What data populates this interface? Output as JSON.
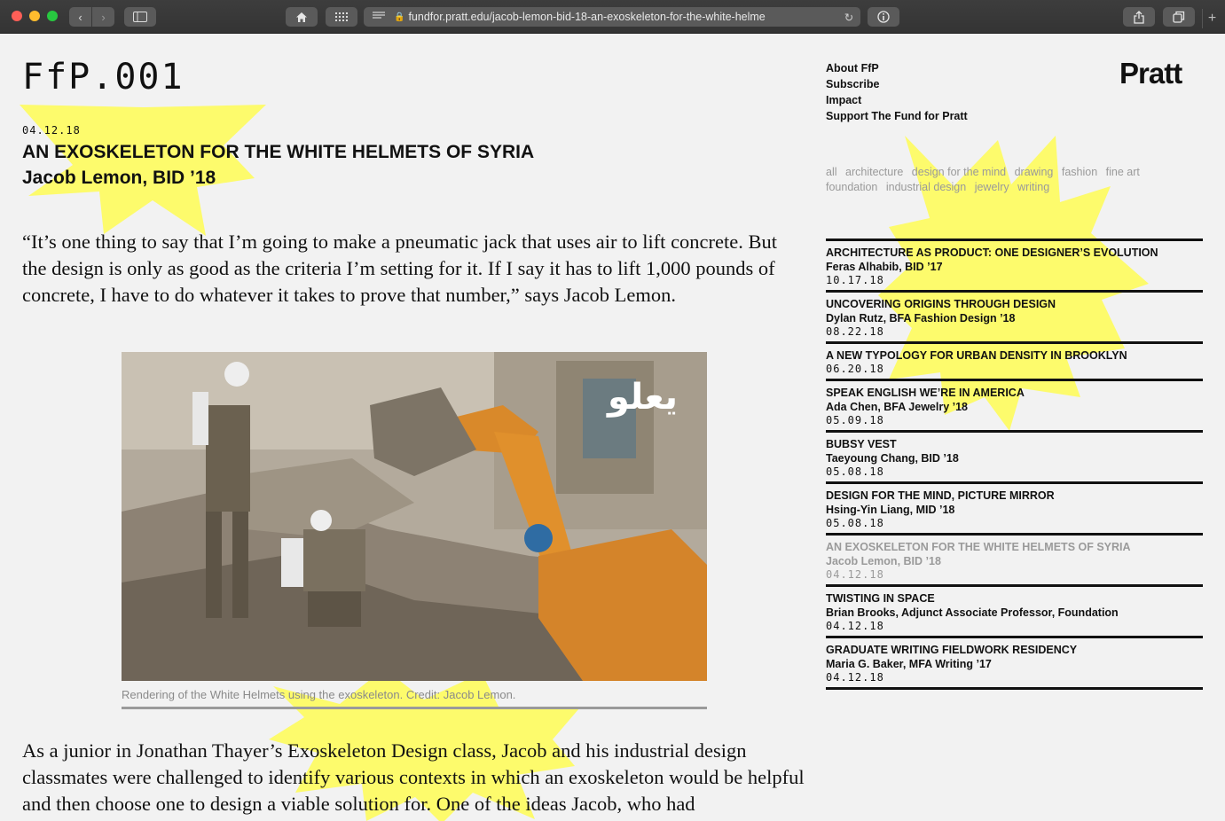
{
  "browser": {
    "url": "fundfor.pratt.edu/jacob-lemon-bid-18-an-exoskeleton-for-the-white-helme",
    "nav_back": "‹",
    "nav_forward": "›",
    "new_tab": "+"
  },
  "site": {
    "logo": "FfP.001",
    "brand": "Pratt",
    "menu": [
      "About FfP",
      "Subscribe",
      "Impact",
      "Support The Fund for Pratt"
    ],
    "filters": [
      "all",
      "architecture",
      "design for the mind",
      "drawing",
      "fashion",
      "fine art",
      "foundation",
      "industrial design",
      "jewelry",
      "writing"
    ]
  },
  "article": {
    "date": "04.12.18",
    "title": "AN EXOSKELETON FOR THE WHITE HELMETS OF SYRIA",
    "author": "Jacob Lemon, BID ’18",
    "paragraph1": "“It’s one thing to say that I’m going to make a pneumatic jack that uses air to lift concrete. But the design is only as good as the criteria I’m setting for it. If I say it has to lift 1,000 pounds of concrete, I have to do whatever it takes to prove that number,” says Jacob Lemon.",
    "image_overlay_text": "يعلو",
    "caption": "Rendering of the White Helmets using the exoskeleton. Credit: Jacob Lemon.",
    "paragraph2": "As a junior in Jonathan Thayer’s Exoskeleton Design class, Jacob and his industrial design classmates were challenged to identify various contexts in which an exoskeleton would be helpful and then choose one to design a viable solution for. One of the ideas Jacob, who had"
  },
  "posts": [
    {
      "title": "ARCHITECTURE AS PRODUCT: ONE DESIGNER’S EVOLUTION",
      "author": "Feras Alhabib, BID ’17",
      "date": "10.17.18"
    },
    {
      "title": "UNCOVERING ORIGINS THROUGH DESIGN",
      "author": "Dylan Rutz, BFA Fashion Design ’18",
      "date": "08.22.18"
    },
    {
      "title": "A NEW TYPOLOGY FOR URBAN DENSITY IN BROOKLYN",
      "author": "",
      "date": "06.20.18"
    },
    {
      "title": "SPEAK ENGLISH WE’RE IN AMERICA",
      "author": "Ada Chen, BFA Jewelry ’18",
      "date": "05.09.18"
    },
    {
      "title": "BUBSY VEST",
      "author": "Taeyoung Chang, BID ’18",
      "date": "05.08.18"
    },
    {
      "title": "DESIGN FOR THE MIND, PICTURE MIRROR",
      "author": "Hsing-Yin Liang, MID ’18",
      "date": "05.08.18"
    },
    {
      "title": "AN EXOSKELETON FOR THE WHITE HELMETS OF SYRIA",
      "author": "Jacob Lemon, BID ’18",
      "date": "04.12.18",
      "current": true
    },
    {
      "title": "TWISTING IN SPACE",
      "author": "Brian Brooks, Adjunct Associate Professor, Foundation",
      "date": "04.12.18"
    },
    {
      "title": "GRADUATE WRITING FIELDWORK RESIDENCY",
      "author": "Maria G. Baker, MFA Writing ’17",
      "date": "04.12.18"
    }
  ],
  "colors": {
    "highlight_star": "#fdfb6c",
    "background": "#f2f2f2",
    "muted_text": "#9a9a9a"
  }
}
